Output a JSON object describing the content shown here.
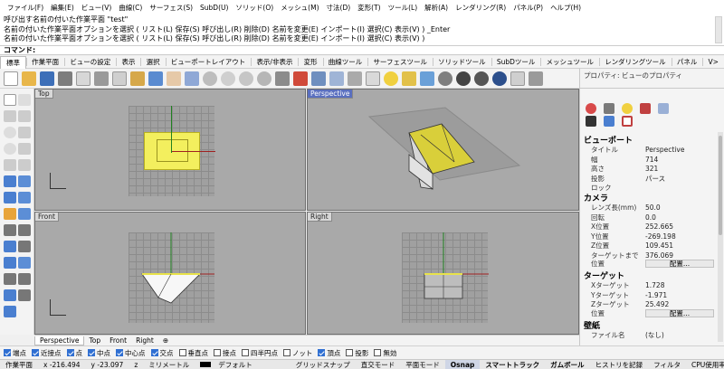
{
  "menu": [
    "ファイル(F)",
    "編集(E)",
    "ビュー(V)",
    "曲線(C)",
    "サーフェス(S)",
    "SubD(U)",
    "ソリッド(O)",
    "メッシュ(M)",
    "寸法(D)",
    "変形(T)",
    "ツール(L)",
    "解析(A)",
    "レンダリング(R)",
    "パネル(P)",
    "ヘルプ(H)"
  ],
  "history": [
    "呼び出す名前の付いた作業平面 \"test\"",
    "名前の付いた作業平面オプションを選択 ( リスト(L)  保存(S)  呼び出し(R)  削除(D)  名前を変更(E)  インポート(I)  選択(C)  表示(V) ) _Enter",
    "名前の付いた作業平面オプションを選択 ( リスト(L)  保存(S)  呼び出し(R)  削除(D)  名前を変更(E)  インポート(I)  選択(C)  表示(V) )"
  ],
  "command_prompt": "コマンド:",
  "tabs": [
    "標準",
    "作業平面",
    "ビューの設定",
    "表示",
    "選択",
    "ビューポートレイアウト",
    "表示/非表示",
    "変形",
    "曲線ツール",
    "サーフェスツール",
    "ソリッドツール",
    "SubDツール",
    "メッシュツール",
    "レンダリングツール",
    "パネル",
    "V>"
  ],
  "active_tab": "標準",
  "viewports": {
    "top": "Top",
    "perspective": "Perspective",
    "front": "Front",
    "right": "Right"
  },
  "viewport_tabs": [
    "Perspective",
    "Top",
    "Front",
    "Right"
  ],
  "viewport_tab_add": "⊕",
  "panel": {
    "title": "プロパティ: ビューのプロパティ",
    "viewport_section": "ビューポート",
    "rows_viewport": [
      {
        "k": "タイトル",
        "v": "Perspective"
      },
      {
        "k": "幅",
        "v": "714"
      },
      {
        "k": "高さ",
        "v": "321"
      },
      {
        "k": "投影",
        "v": "パース"
      },
      {
        "k": "ロック",
        "v": ""
      }
    ],
    "camera_section": "カメラ",
    "rows_camera": [
      {
        "k": "レンズ長(mm)",
        "v": "50.0"
      },
      {
        "k": "回転",
        "v": "0.0"
      },
      {
        "k": "X位置",
        "v": "252.665"
      },
      {
        "k": "Y位置",
        "v": "-269.198"
      },
      {
        "k": "Z位置",
        "v": "109.451"
      },
      {
        "k": "ターゲットまで",
        "v": "376.069"
      }
    ],
    "position_label": "位置",
    "place_button": "配置...",
    "target_section": "ターゲット",
    "rows_target": [
      {
        "k": "Xターゲット",
        "v": "1.728"
      },
      {
        "k": "Yターゲット",
        "v": "-1.971"
      },
      {
        "k": "Zターゲット",
        "v": "25.492"
      }
    ],
    "wallpaper_section": "壁紙",
    "rows_wallpaper": [
      {
        "k": "ファイル名",
        "v": "(なし)"
      }
    ]
  },
  "osnap": [
    {
      "label": "端点",
      "on": true
    },
    {
      "label": "近接点",
      "on": true
    },
    {
      "label": "点",
      "on": true
    },
    {
      "label": "中点",
      "on": true
    },
    {
      "label": "中心点",
      "on": true
    },
    {
      "label": "交点",
      "on": true
    },
    {
      "label": "垂直点",
      "on": false
    },
    {
      "label": "接点",
      "on": false
    },
    {
      "label": "四半円点",
      "on": false
    },
    {
      "label": "ノット",
      "on": false
    },
    {
      "label": "頂点",
      "on": true
    },
    {
      "label": "投影",
      "on": false
    },
    {
      "label": "無効",
      "on": false
    }
  ],
  "status": {
    "cplane": "作業平面",
    "x": "x -216.494",
    "y": "y -23.097",
    "z": "z",
    "units": "ミリメートル",
    "layer": "デフォルト",
    "grid_snap": "グリッドスナップ",
    "ortho": "直交モード",
    "planar": "平面モード",
    "osnap": "Osnap",
    "smarttrack": "スマートトラック",
    "gumball": "ガムボール",
    "history": "ヒストリを記録",
    "filter": "フィルタ",
    "cpu": "CPU使用率"
  },
  "colors": {
    "viewport_bg": "#a9a9a9",
    "selection_yellow": "#e8e24a",
    "active_title": "#5a6fbf"
  }
}
